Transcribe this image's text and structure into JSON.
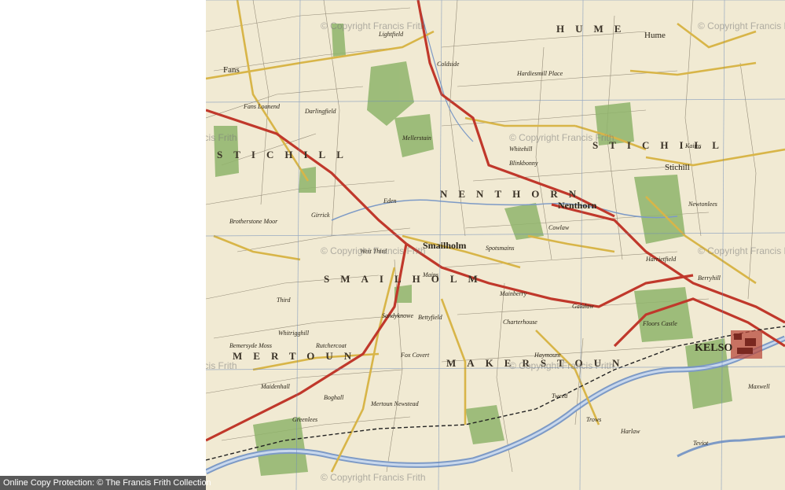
{
  "map": {
    "settlements": {
      "smailholm": "Smailholm",
      "nenthorn": "Nenthorn",
      "kelso": "KELSO",
      "stichill": "Stichill",
      "hume": "Hume",
      "mellerstain": "Mellerstain",
      "makerstoun_label": "MAKERSTOUN",
      "smailholm_parish": "SMAILHOLM",
      "nenthorn_parish": "NENTHORN",
      "mertoun_parish": "MERTOUN",
      "hume_parish": "HUME",
      "stichill_parish": "STICHILL",
      "bettyfield": "Bettyfield",
      "sandyknowe": "Sandyknowe",
      "whitehill": "Whitehill",
      "charterhouse": "Charterhouse",
      "mainberry": "Mainberry",
      "floors_castle": "Floors Castle",
      "newtonlees": "Newtonlees",
      "fans": "Fans",
      "coldside": "Coldside",
      "lightfield": "Lightfield",
      "west_third": "West Third",
      "spotsmains": "Spotsmains",
      "haymount": "Haymount",
      "galalaw": "Galalaw",
      "hardiesmill": "Hardiesmill Place",
      "blinkbonny": "Blinkbonny",
      "crocklaw": "Cowlaw",
      "harrietfield": "Harrietfield",
      "berryhill": "Berryhill",
      "maxwellheugh": "Maxwell",
      "trows": "Trows",
      "harlaw": "Harlaw",
      "kaimes": "Kaims",
      "fox_covert": "Fox Covert",
      "mains": "Mains",
      "third": "Third",
      "girrick": "Girrick",
      "eden_river": "Eden",
      "tweed": "Tweed",
      "teviot": "Teviot",
      "boghall": "Boghall",
      "maidenhall": "Maidenhall",
      "whitrigghill": "Whitrigghill",
      "greenlees": "Greenlees",
      "newstead": "Mertoun Newstead",
      "fans_loanend": "Fans Loanend",
      "darlingfield": "Darlingfield",
      "brotherstone_moor": "Brotherstone Moor",
      "bemersyde_moss": "Bemersyde Moss",
      "rutchercoat": "Rutchercoat"
    },
    "watermarks": [
      "© Copyright Francis Frith",
      "© Copyright Francis Frith",
      "© Copyright Francis Frith",
      "© Copyright Francis Frith",
      "© Copyright Francis Frith",
      "© Copyright Francis Frith",
      "© Copyright Francis Frith",
      "© Copyright Francis Frith",
      "© Copyright Francis Frith"
    ],
    "colors": {
      "road_red": "#c0382b",
      "road_yellow": "#d8b548",
      "water": "#7d9ac6",
      "wood": "#8fb46b",
      "paper": "#f1ead3",
      "grid": "#6a88b8"
    }
  },
  "footer": {
    "text": "Online Copy Protection:  © The Francis Frith Collection"
  }
}
